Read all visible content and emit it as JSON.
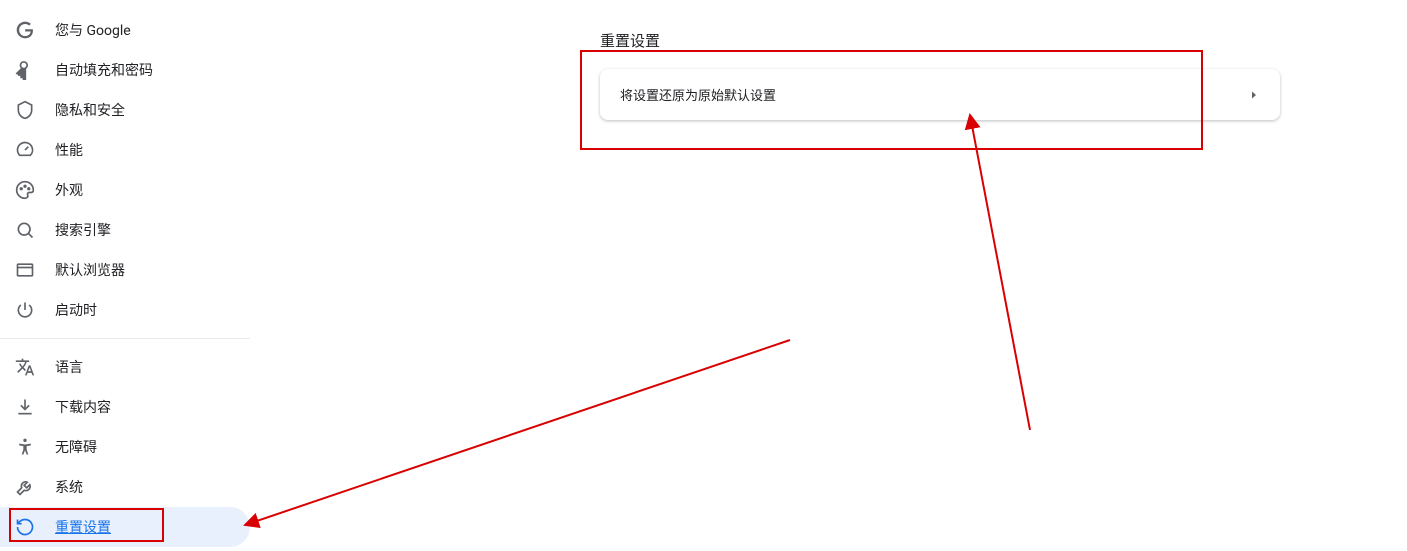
{
  "sidebar": {
    "items": [
      {
        "id": "you-and-google",
        "label": "您与 Google"
      },
      {
        "id": "autofill",
        "label": "自动填充和密码"
      },
      {
        "id": "privacy",
        "label": "隐私和安全"
      },
      {
        "id": "performance",
        "label": "性能"
      },
      {
        "id": "appearance",
        "label": "外观"
      },
      {
        "id": "search-engine",
        "label": "搜索引擎"
      },
      {
        "id": "default-browser",
        "label": "默认浏览器"
      },
      {
        "id": "on-startup",
        "label": "启动时"
      }
    ],
    "items2": [
      {
        "id": "languages",
        "label": "语言"
      },
      {
        "id": "downloads",
        "label": "下载内容"
      },
      {
        "id": "accessibility",
        "label": "无障碍"
      },
      {
        "id": "system",
        "label": "系统"
      },
      {
        "id": "reset",
        "label": "重置设置"
      }
    ]
  },
  "main": {
    "section_title": "重置设置",
    "reset_card_label": "将设置还原为原始默认设置"
  },
  "annotation": {
    "color": "#d80000"
  }
}
